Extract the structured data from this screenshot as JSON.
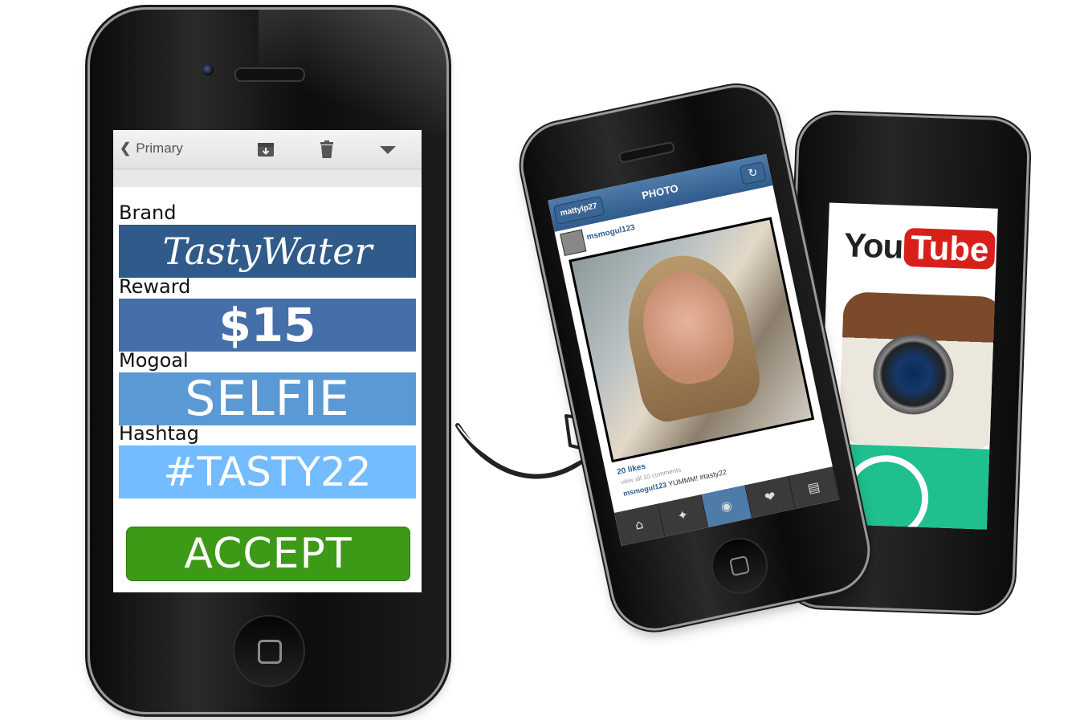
{
  "email": {
    "back_label": "Primary",
    "brand_label": "Brand",
    "brand_value": "TastyWater",
    "reward_label": "Reward",
    "reward_value": "$15",
    "mogoal_label": "Mogoal",
    "mogoal_value": "SELFIE",
    "hashtag_label": "Hashtag",
    "hashtag_value": "#TASTY22",
    "accept_label": "ACCEPT",
    "icons": [
      "archive-icon",
      "trash-icon",
      "dropdown-icon"
    ]
  },
  "instagram": {
    "back_label": "mattylp27",
    "title": "PHOTO",
    "username": "msmogul123",
    "likes": "20 likes",
    "comments_link": "view all 10 comments",
    "caption_user": "msmogul123",
    "caption_text": "YUMMM! #tasty22",
    "tabs": [
      "home-icon",
      "explore-icon",
      "camera-icon",
      "news-icon",
      "profile-icon"
    ]
  },
  "apps": {
    "youtube_you": "You",
    "youtube_tube": "Tube"
  },
  "colors": {
    "brand": "#2f5a8a",
    "reward": "#456fa8",
    "mogoal": "#5b99d4",
    "hashtag": "#72bcff",
    "accept": "#3c9a17"
  }
}
